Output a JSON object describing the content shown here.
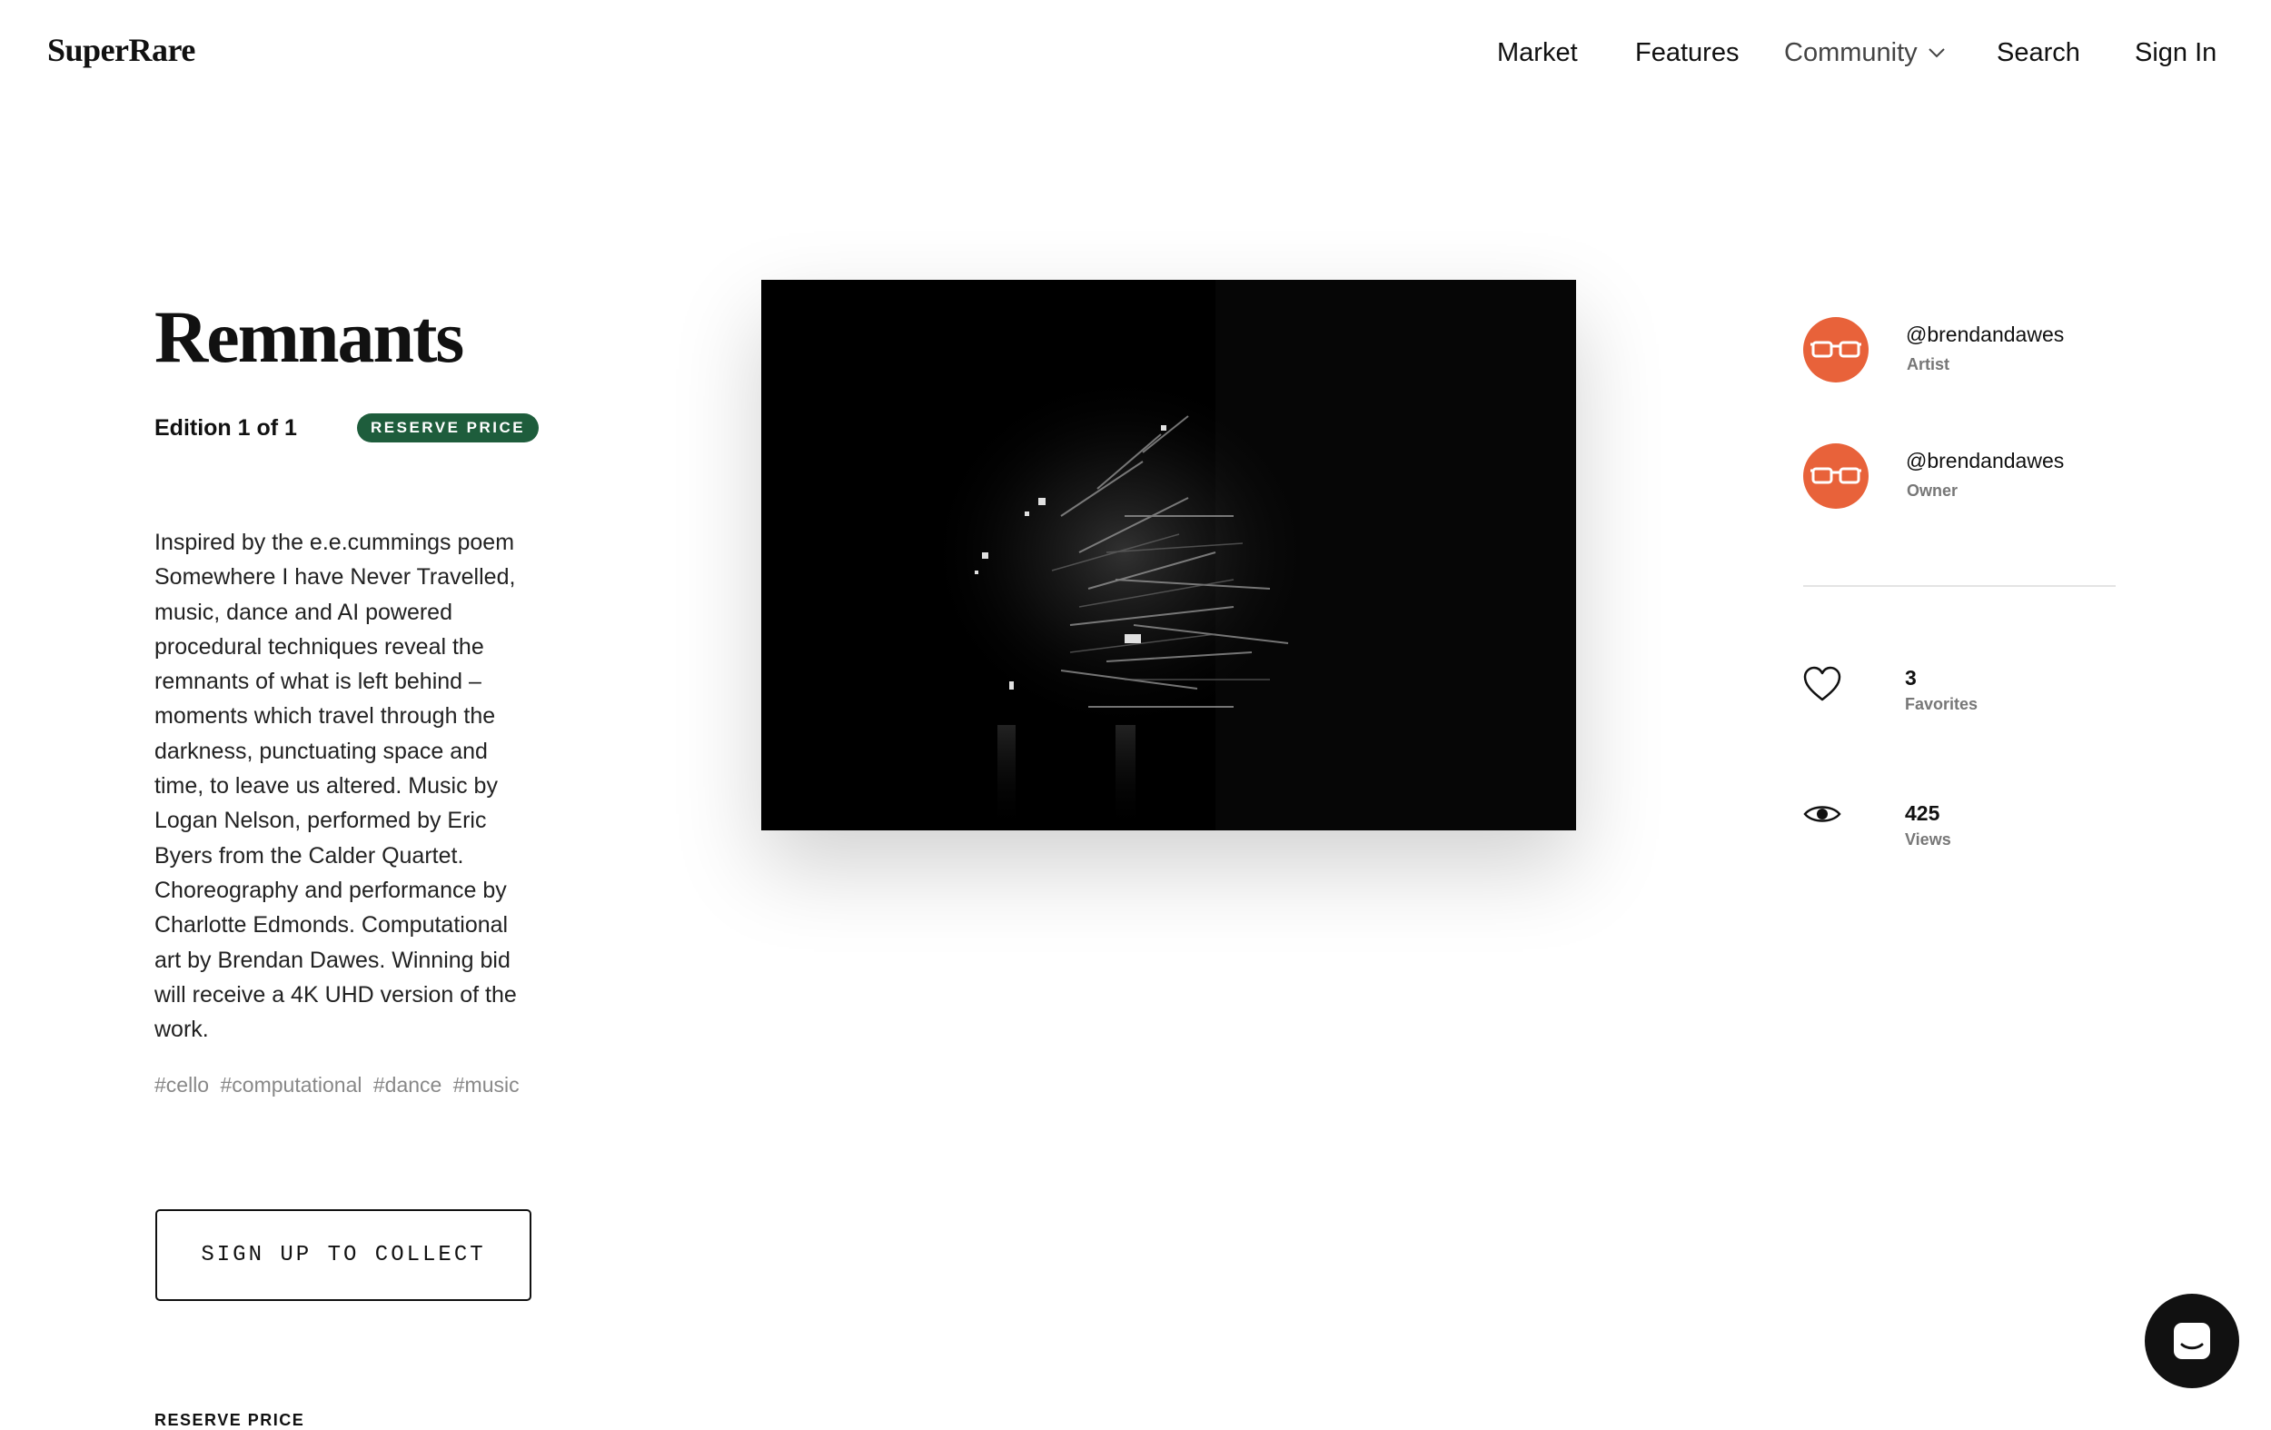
{
  "header": {
    "logo": "SuperRare",
    "nav": {
      "market": "Market",
      "features": "Features",
      "community": "Community",
      "search": "Search",
      "sign_in": "Sign In"
    }
  },
  "artwork": {
    "title": "Remnants",
    "edition": "Edition 1 of 1",
    "badge": "RESERVE PRICE",
    "description": "Inspired by the e.e.cummings poem Somewhere I have Never Travelled, music, dance and AI powered procedural techniques reveal the remnants of what is left behind – moments which travel through the darkness, punctuating space and time, to leave us altered. Music by Logan Nelson, performed by Eric Byers from the Calder Quartet. Choreography and performance by Charlotte Edmonds. Computational art by Brendan Dawes. Winning bid will receive a 4K UHD version of the work.",
    "tags": [
      "#cello",
      "#computational",
      "#dance",
      "#music"
    ],
    "collect_button": "SIGN UP TO COLLECT",
    "reserve_label": "RESERVE PRICE"
  },
  "people": {
    "artist": {
      "handle": "@brendandawes",
      "role": "Artist",
      "avatar_icon": "glasses-icon"
    },
    "owner": {
      "handle": "@brendandawes",
      "role": "Owner",
      "avatar_icon": "glasses-icon"
    }
  },
  "stats": {
    "favorites": {
      "value": "3",
      "label": "Favorites",
      "icon": "heart-icon"
    },
    "views": {
      "value": "425",
      "label": "Views",
      "icon": "eye-icon"
    }
  },
  "colors": {
    "badge_green": "#1e5d3c",
    "avatar_orange": "#e8623a",
    "chat_button": "#111111"
  }
}
